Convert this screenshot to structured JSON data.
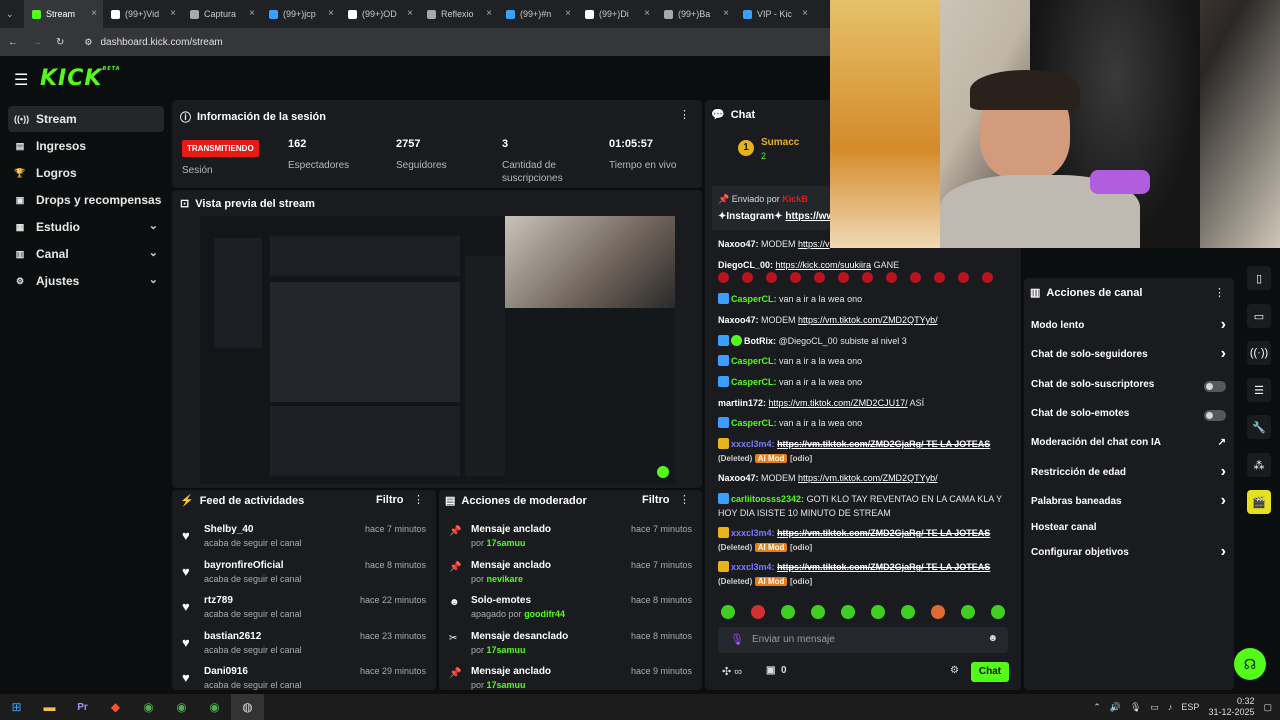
{
  "browser": {
    "tabs": [
      {
        "label": "Stream",
        "active": true
      },
      {
        "label": "(99+)Vid"
      },
      {
        "label": "Captura"
      },
      {
        "label": "(99+)jcp"
      },
      {
        "label": "(99+)OD"
      },
      {
        "label": "Reflexio"
      },
      {
        "label": "(99+)#n"
      },
      {
        "label": "(99+)Di"
      },
      {
        "label": "(99+)Ba"
      },
      {
        "label": "VIP - Kic"
      }
    ],
    "url": "dashboard.kick.com/stream"
  },
  "logo": {
    "text": "KICK",
    "sup": "BETA"
  },
  "sidebar": {
    "items": [
      {
        "label": "Stream",
        "icon": "broadcast-icon"
      },
      {
        "label": "Ingresos",
        "icon": "money-icon"
      },
      {
        "label": "Logros",
        "icon": "trophy-icon"
      },
      {
        "label": "Drops y recompensas",
        "icon": "gift-icon"
      },
      {
        "label": "Estudio",
        "icon": "clapper-icon",
        "chevron": "v"
      },
      {
        "label": "Canal",
        "icon": "channel-icon",
        "chevron": "v"
      },
      {
        "label": "Ajustes",
        "icon": "gear-icon",
        "chevron": "v"
      }
    ]
  },
  "session": {
    "title": "Información de la sesión",
    "status": "TRANSMITIENDO",
    "status_label": "Sesión",
    "stats": [
      {
        "value": "162",
        "label": "Espectadores"
      },
      {
        "value": "2757",
        "label": "Seguidores"
      },
      {
        "value": "3",
        "label": "Cantidad de suscripciones"
      },
      {
        "value": "01:05:57",
        "label": "Tiempo en vivo"
      }
    ]
  },
  "preview": {
    "title": "Vista previa del stream"
  },
  "feed": {
    "title": "Feed de actividades",
    "filter": "Filtro",
    "items": [
      {
        "name": "Shelby_40",
        "sub": "acaba de seguir el canal",
        "time": "hace 7 minutos"
      },
      {
        "name": "bayronfireOficial",
        "sub": "acaba de seguir el canal",
        "time": "hace 8 minutos"
      },
      {
        "name": "rtz789",
        "sub": "acaba de seguir el canal",
        "time": "hace 22 minutos"
      },
      {
        "name": "bastian2612",
        "sub": "acaba de seguir el canal",
        "time": "hace 23 minutos"
      },
      {
        "name": "Dani0916",
        "sub": "acaba de seguir el canal",
        "time": "hace 29 minutos"
      }
    ]
  },
  "mod": {
    "title": "Acciones de moderador",
    "filter": "Filtro",
    "items": [
      {
        "title": "Mensaje anclado",
        "by": "por",
        "user": "17samuu",
        "time": "hace 7 minutos",
        "icon": "pin-icon"
      },
      {
        "title": "Mensaje anclado",
        "by": "por",
        "user": "nevikare",
        "time": "hace 7 minutos",
        "icon": "pin-icon"
      },
      {
        "title": "Solo-emotes",
        "by": "apagado por",
        "user": "goodifr44",
        "time": "hace 8 minutos",
        "icon": "smile-icon"
      },
      {
        "title": "Mensaje desanclado",
        "by": "por",
        "user": "17samuu",
        "time": "hace 8 minutos",
        "icon": "unpin-icon"
      },
      {
        "title": "Mensaje anclado",
        "by": "por",
        "user": "17samuu",
        "time": "hace 9 minutos",
        "icon": "pin-icon"
      }
    ]
  },
  "chat": {
    "title": "Chat",
    "top_user": "Sumacc",
    "top_rank": "1",
    "top_count": "2",
    "pinned_by": "Enviado por",
    "pinned_user": "KickB",
    "pinned_text": "✦Instagram✦",
    "pinned_link": "https://ww",
    "messages": [
      {
        "user": "Naxoo47:",
        "color": "#ffffff",
        "text": "MODEM",
        "link": "https://v"
      },
      {
        "user": "DiegoCL_00:",
        "color": "#ffffff",
        "text": "",
        "link": "https://kick.com/suukiira",
        "after": "GANE"
      },
      {
        "user": "CasperCL:",
        "color": "#53fc18",
        "text": "van a ir a la wea ono"
      },
      {
        "user": "Naxoo47:",
        "color": "#ffffff",
        "text": "MODEM",
        "link": "https://vm.tiktok.com/ZMD2QTYyb/"
      },
      {
        "user": "BotRix:",
        "color": "#ffffff",
        "text": "@DiegoCL_00 subiste al nivel 3"
      },
      {
        "user": "CasperCL:",
        "color": "#53fc18",
        "text": "van a ir a la wea ono"
      },
      {
        "user": "CasperCL:",
        "color": "#53fc18",
        "text": "van a ir a la wea ono"
      },
      {
        "user": "martiin172:",
        "color": "#ffffff",
        "text": "",
        "link": "https://vm.tiktok.com/ZMD2CJU17/",
        "after": "ASÍ"
      },
      {
        "user": "CasperCL:",
        "color": "#53fc18",
        "text": "van a ir a la wea ono"
      },
      {
        "user": "xxxcl3m4:",
        "color": "#7a7aff",
        "text": "",
        "link": "https://vm.tiktok.com/ZMD2GjaRg/ TE LA JOTEAS",
        "deleted": "(Deleted)",
        "mod": "AI Mod",
        "tag": "[odio]"
      },
      {
        "user": "Naxoo47:",
        "color": "#ffffff",
        "text": "MODEM",
        "link": "https://vm.tiktok.com/ZMD2QTYyb/"
      },
      {
        "user": "carliitoosss2342:",
        "color": "#53fc18",
        "text": "GOTI KLO TAY REVENTAO EN LA CAMA KLA Y HOY DIA ISISTE 10 MINUTO DE STREAM"
      },
      {
        "user": "xxxcl3m4:",
        "color": "#7a7aff",
        "text": "",
        "link": "https://vm.tiktok.com/ZMD2GjaRg/ TE LA JOTEAS",
        "deleted": "(Deleted)",
        "mod": "AI Mod",
        "tag": "[odio]"
      },
      {
        "user": "xxxcl3m4:",
        "color": "#7a7aff",
        "text": "",
        "link": "https://vm.tiktok.com/ZMD2GjaRg/ TE LA JOTEAS",
        "deleted": "(Deleted)",
        "mod": "AI Mod",
        "tag": "[odio]"
      }
    ],
    "input_placeholder": "Enviar un mensaje",
    "infinity": "∞",
    "gift_count": "0",
    "send_label": "Chat"
  },
  "channel_actions": {
    "title": "Acciones de canal",
    "items": [
      {
        "label": "Modo lento",
        "kind": "chevron"
      },
      {
        "label": "Chat de solo-seguidores",
        "kind": "chevron"
      },
      {
        "label": "Chat de solo-suscriptores",
        "kind": "toggle"
      },
      {
        "label": "Chat de solo-emotes",
        "kind": "toggle"
      },
      {
        "label": "Moderación del chat con IA",
        "kind": "external"
      },
      {
        "label": "Restricción de edad",
        "kind": "chevron"
      },
      {
        "label": "Palabras baneadas",
        "kind": "chevron"
      },
      {
        "label": "Hostear canal",
        "kind": "none"
      },
      {
        "label": "Configurar objetivos",
        "kind": "chevron"
      }
    ]
  },
  "tray": {
    "lang": "ESP",
    "time": "0:32",
    "date": "31-12-2025"
  },
  "colors": {
    "accent": "#53fc18",
    "live": "#e91916",
    "panel": "#191b1f",
    "bg": "#0b0e0f"
  }
}
